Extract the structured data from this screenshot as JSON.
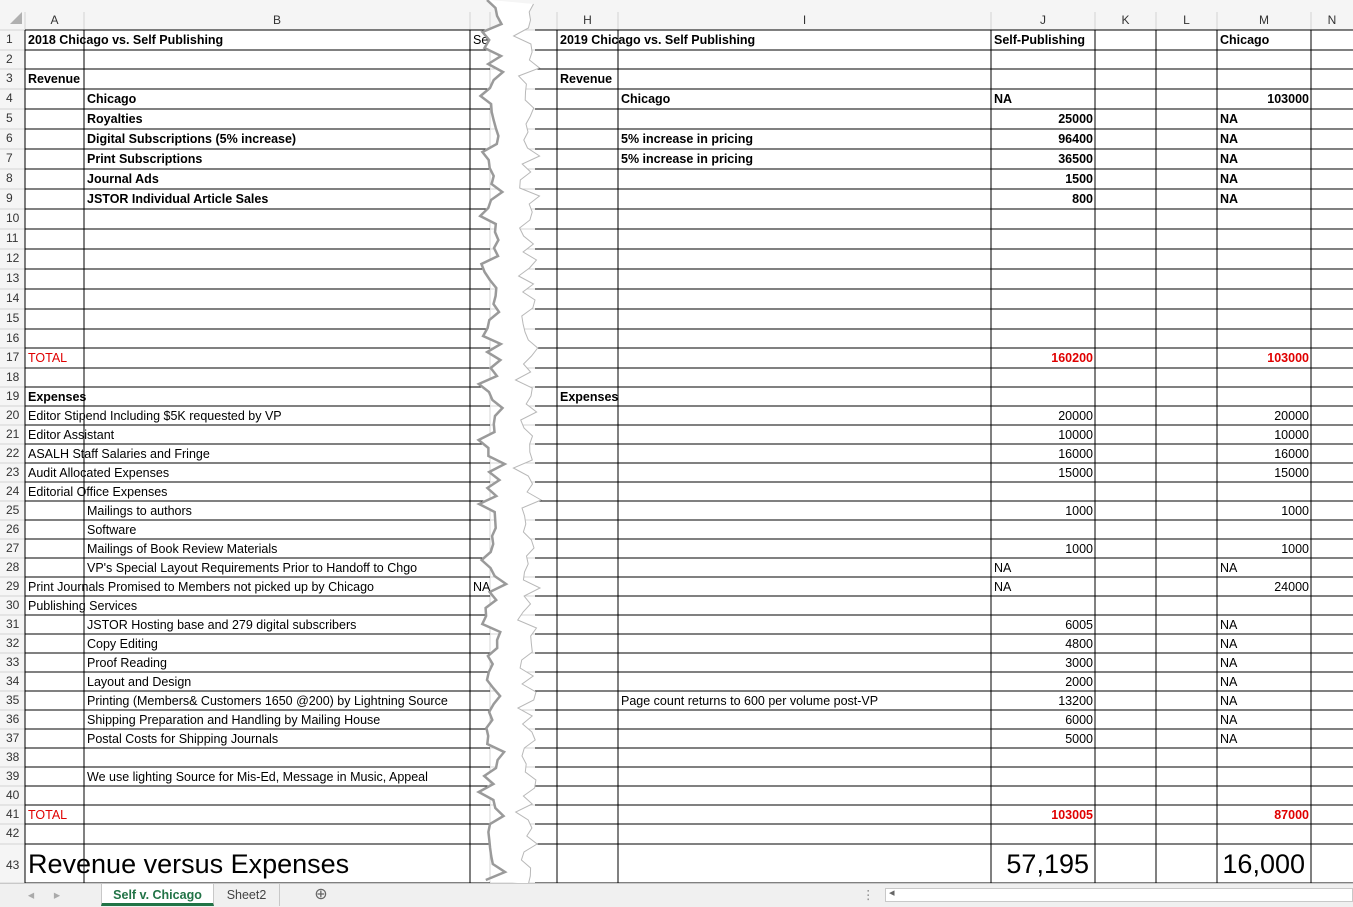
{
  "columns": {
    "A": "A",
    "B": "B",
    "H": "H",
    "I": "I",
    "J": "J",
    "K": "K",
    "L": "L",
    "M": "M",
    "N": "N"
  },
  "cells": {
    "A1": "2018 Chicago vs. Self Publishing",
    "C1": "Se",
    "A3": "Revenue",
    "B4": "Chicago",
    "B5": "Royalties",
    "B6": "Digital Subscriptions (5% increase)",
    "B7": "Print Subscriptions",
    "B8": "Journal Ads",
    "B9": "JSTOR Individual Article Sales",
    "A17": "TOTAL",
    "A19": "Expenses",
    "A20": "Editor Stipend Including $5K requested by VP",
    "A21": "Editor Assistant",
    "A22": "ASALH Staff Salaries and Fringe",
    "A23": "Audit Allocated Expenses",
    "A24": "Editorial Office Expenses",
    "B25": "Mailings to authors",
    "B26": "Software",
    "B27": "Mailings of Book Review Materials",
    "B28": "VP's Special Layout Requirements Prior to Handoff to Chgo",
    "A29": "Print Journals Promised to Members not picked up by Chicago",
    "C29": "NA",
    "A30": "Publishing Services",
    "B31": "JSTOR Hosting base and 279 digital subscribers",
    "B32": "Copy Editing",
    "B33": "Proof Reading",
    "B34": "Layout and Design",
    "B35": "Printing (Members& Customers 1650 @200) by Lightning Source",
    "B36": "Shipping Preparation and Handling by Mailing House",
    "B37": "Postal Costs for Shipping Journals",
    "B39": "We use lighting Source for Mis-Ed, Message in Music, Appeal",
    "A41": "TOTAL",
    "A43": "Revenue versus Expenses",
    "H1": "2019 Chicago vs. Self Publishing",
    "J1": "Self-Publishing",
    "M1": "Chicago",
    "H3": "Revenue",
    "I4": "Chicago",
    "J4": "NA",
    "M4": "103000",
    "J5": "25000",
    "M5": "NA",
    "I6": "5% increase in pricing",
    "J6": "96400",
    "M6": "NA",
    "I7": "5% increase in pricing",
    "J7": "36500",
    "M7": "NA",
    "J8": "1500",
    "M8": "NA",
    "J9": "800",
    "M9": "NA",
    "J17": "160200",
    "M17": "103000",
    "H19": "Expenses",
    "J20": "20000",
    "M20": "20000",
    "J21": "10000",
    "M21": "10000",
    "J22": "16000",
    "M22": "16000",
    "J23": "15000",
    "M23": "15000",
    "J25": "1000",
    "M25": "1000",
    "J27": "1000",
    "M27": "1000",
    "J28": "NA",
    "M28": "NA",
    "J29": "NA",
    "M29": "24000",
    "J31": "6005",
    "M31": "NA",
    "J32": "4800",
    "M32": "NA",
    "J33": "3000",
    "M33": "NA",
    "J34": "2000",
    "M34": "NA",
    "I35": "Page count returns to 600 per volume post-VP",
    "J35": "13200",
    "M35": "NA",
    "J36": "6000",
    "M36": "NA",
    "J37": "5000",
    "M37": "NA",
    "J41": "103005",
    "M41": "87000",
    "J43": "57,195",
    "M43": "16,000"
  },
  "tabs": {
    "active": "Self v. Chicago",
    "second": "Sheet2",
    "add_symbol": "⊕",
    "scroll_left": "◂",
    "scroll_right": "▸",
    "hscroll_left": "◂",
    "dots": "⋮"
  },
  "colors": {
    "grid": "#d4d4d4",
    "border": "#000000",
    "header_bg": "#f5f5f5",
    "total_red": "#e00000",
    "active_tab_text": "#217346"
  }
}
